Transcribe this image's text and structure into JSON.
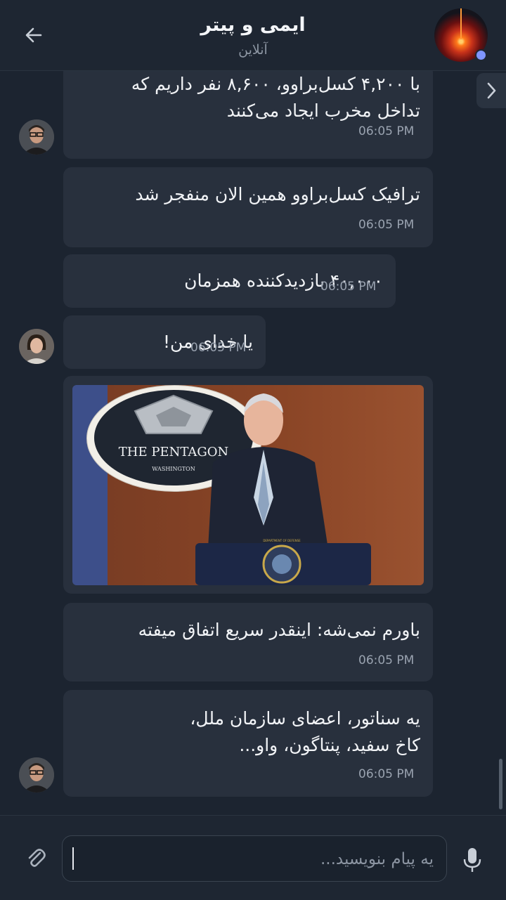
{
  "header": {
    "title": "ایمی و پیتر",
    "status": "آنلاین"
  },
  "messages": [
    {
      "lines": [
        "با ۴,۲۰۰ کسل‌براوو، ۸,۶۰۰ نفر داریم که",
        "تداخل مخرب ایجاد می‌کنند"
      ],
      "time": "06:05 PM"
    },
    {
      "lines": [
        "ترافیک کسل‌براوو همین الان منفجر شد"
      ],
      "time": "06:05 PM"
    },
    {
      "lines": [
        "۴۰,۰۰۰ بازدیدکننده همزمان"
      ],
      "time": "06:05 PM"
    },
    {
      "lines": [
        "یا خدای من!"
      ],
      "time": "06:05 PM"
    },
    {
      "lines": [
        "باورم نمی‌شه: اینقدر سریع اتفاق میفته"
      ],
      "time": "06:05 PM"
    },
    {
      "lines": [
        "یه سناتور، اعضای سازمان ملل،",
        "کاخ سفید، پنتاگون، واو..."
      ],
      "time": "06:05 PM"
    }
  ],
  "photo": {
    "sign_title": "THE PENTAGON",
    "sign_subtitle": "WASHINGTON",
    "seal_text": "DEPARTMENT OF DEFENSE"
  },
  "composer": {
    "placeholder": "یه پیام بنویسید..."
  },
  "icons": {
    "back": "arrow-left-icon",
    "expand": "chevron-right-icon",
    "attach": "paperclip-icon",
    "mic": "microphone-icon"
  },
  "colors": {
    "background": "#1c2430",
    "bubble": "#28303d",
    "online": "#7f95ff"
  }
}
